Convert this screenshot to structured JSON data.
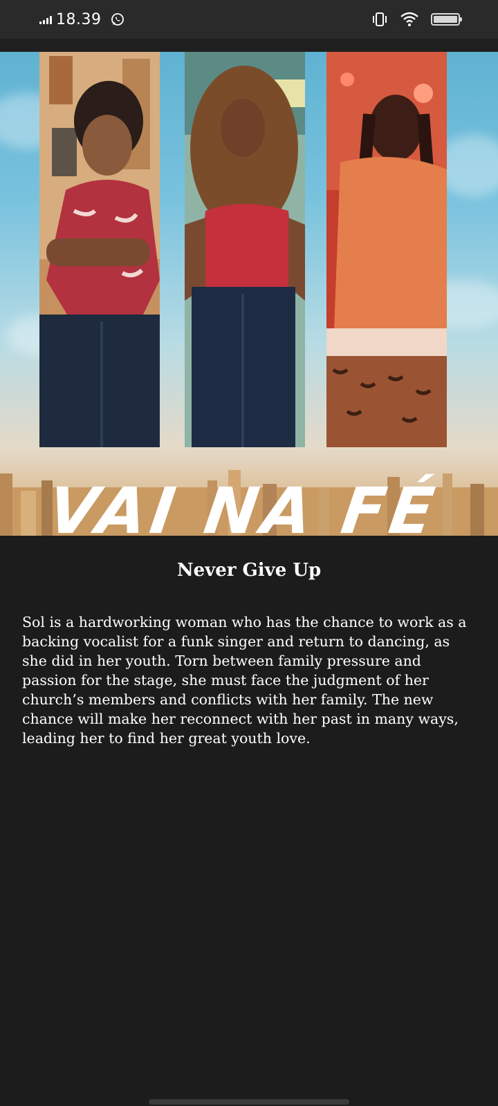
{
  "status_bar": {
    "time": "18.39",
    "icons": [
      "signal-icon",
      "whatsapp-icon",
      "vibrate-icon",
      "wifi-icon",
      "battery-icon"
    ]
  },
  "poster": {
    "title_text": "VAI NA FÉ"
  },
  "article": {
    "title": "Never Give Up",
    "description": "Sol is a hardworking woman who has the chance to work as a backing vocalist for a funk singer and return to dancing, as she did in her youth. Torn between family pressure and passion for the stage, she must face the judgment of her church’s members and conflicts with her family. The new chance will make her reconnect with her past in many ways, leading her to find her great youth love."
  },
  "colors": {
    "background": "#1c1c1d",
    "status_bar": "#2a2a2b",
    "text": "#ffffff"
  }
}
